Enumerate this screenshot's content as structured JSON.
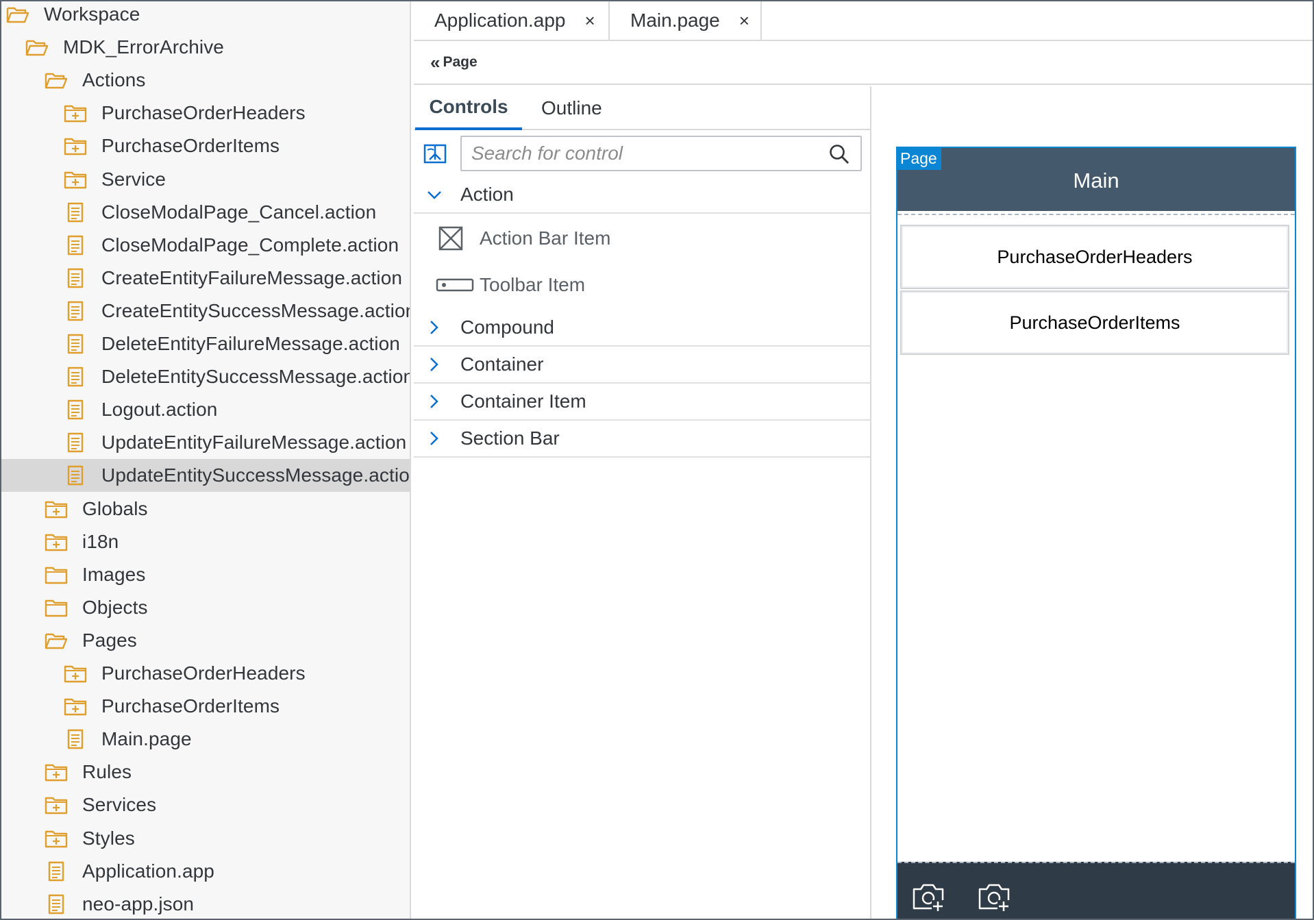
{
  "workspace_tree": [
    {
      "label": "Workspace",
      "icon": "folder-open-icon",
      "indent": 0
    },
    {
      "label": "MDK_ErrorArchive",
      "icon": "folder-open-icon",
      "indent": 1
    },
    {
      "label": "Actions",
      "icon": "folder-open-icon",
      "indent": 2
    },
    {
      "label": "PurchaseOrderHeaders",
      "icon": "folder-plus-icon",
      "indent": 3
    },
    {
      "label": "PurchaseOrderItems",
      "icon": "folder-plus-icon",
      "indent": 3
    },
    {
      "label": "Service",
      "icon": "folder-plus-icon",
      "indent": 3
    },
    {
      "label": "CloseModalPage_Cancel.action",
      "icon": "file-icon",
      "indent": 3
    },
    {
      "label": "CloseModalPage_Complete.action",
      "icon": "file-icon",
      "indent": 3
    },
    {
      "label": "CreateEntityFailureMessage.action",
      "icon": "file-icon",
      "indent": 3
    },
    {
      "label": "CreateEntitySuccessMessage.action",
      "icon": "file-icon",
      "indent": 3
    },
    {
      "label": "DeleteEntityFailureMessage.action",
      "icon": "file-icon",
      "indent": 3
    },
    {
      "label": "DeleteEntitySuccessMessage.action",
      "icon": "file-icon",
      "indent": 3
    },
    {
      "label": "Logout.action",
      "icon": "file-icon",
      "indent": 3
    },
    {
      "label": "UpdateEntityFailureMessage.action",
      "icon": "file-icon",
      "indent": 3
    },
    {
      "label": "UpdateEntitySuccessMessage.action",
      "icon": "file-icon",
      "indent": 3,
      "selected": true
    },
    {
      "label": "Globals",
      "icon": "folder-plus-icon",
      "indent": 2
    },
    {
      "label": "i18n",
      "icon": "folder-plus-icon",
      "indent": 2
    },
    {
      "label": "Images",
      "icon": "folder-icon",
      "indent": 2
    },
    {
      "label": "Objects",
      "icon": "folder-icon",
      "indent": 2
    },
    {
      "label": "Pages",
      "icon": "folder-open-icon",
      "indent": 2
    },
    {
      "label": "PurchaseOrderHeaders",
      "icon": "folder-plus-icon",
      "indent": 3
    },
    {
      "label": "PurchaseOrderItems",
      "icon": "folder-plus-icon",
      "indent": 3
    },
    {
      "label": "Main.page",
      "icon": "file-icon",
      "indent": 3
    },
    {
      "label": "Rules",
      "icon": "folder-plus-icon",
      "indent": 2
    },
    {
      "label": "Services",
      "icon": "folder-plus-icon",
      "indent": 2
    },
    {
      "label": "Styles",
      "icon": "folder-plus-icon",
      "indent": 2
    },
    {
      "label": "Application.app",
      "icon": "file-icon",
      "indent": 2
    },
    {
      "label": "neo-app.json",
      "icon": "file-icon",
      "indent": 2
    }
  ],
  "editor_tabs": [
    {
      "label": "Application.app",
      "close": "×"
    },
    {
      "label": "Main.page",
      "close": "×"
    }
  ],
  "breadcrumb": {
    "chevron": "«",
    "label": "Page"
  },
  "controls_panel": {
    "tabs": [
      {
        "label": "Controls",
        "active": true
      },
      {
        "label": "Outline",
        "active": false
      }
    ],
    "search": {
      "placeholder": "Search for control",
      "value": ""
    },
    "groups": [
      {
        "label": "Action",
        "expanded": true,
        "items": [
          {
            "label": "Action Bar Item",
            "icon": "action-bar-item-icon"
          },
          {
            "label": "Toolbar Item",
            "icon": "toolbar-item-icon"
          }
        ]
      },
      {
        "label": "Compound",
        "expanded": false
      },
      {
        "label": "Container",
        "expanded": false
      },
      {
        "label": "Container Item",
        "expanded": false
      },
      {
        "label": "Section Bar",
        "expanded": false
      }
    ]
  },
  "canvas": {
    "page_tag": "Page",
    "title": "Main",
    "sections": [
      "PurchaseOrderHeaders",
      "PurchaseOrderItems"
    ],
    "footer_icons": [
      "camera-add-icon",
      "camera-add-icon"
    ]
  },
  "colors": {
    "folder_icon": "#e09e2d",
    "selection": "#0a86d4",
    "phone_header": "#45596c",
    "phone_footer": "#2f3b47",
    "active_tab_underline": "#0a6ed1"
  }
}
